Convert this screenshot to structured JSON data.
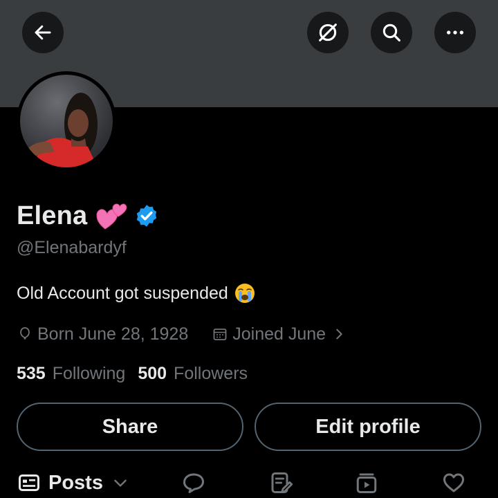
{
  "header": {
    "icons": [
      "back-arrow-icon",
      "grok-icon",
      "search-icon",
      "more-icon"
    ]
  },
  "profile": {
    "display_name": "Elena",
    "handle": "@Elenabardyf",
    "bio": "Old Account got suspended",
    "born": "Born June 28, 1928",
    "joined": "Joined June",
    "following_count": "535",
    "following_label": "Following",
    "followers_count": "500",
    "followers_label": "Followers"
  },
  "actions": {
    "share_label": "Share",
    "edit_label": "Edit profile"
  },
  "tabs": {
    "posts_label": "Posts",
    "icons": [
      "posts-icon",
      "replies-icon",
      "articles-icon",
      "media-icon",
      "likes-icon"
    ]
  },
  "colors": {
    "background": "#000000",
    "banner": "#3a3d40",
    "text_primary": "#e7e9ea",
    "text_secondary": "#71767b",
    "verified_blue": "#1d9bf0",
    "button_border": "#536471"
  }
}
